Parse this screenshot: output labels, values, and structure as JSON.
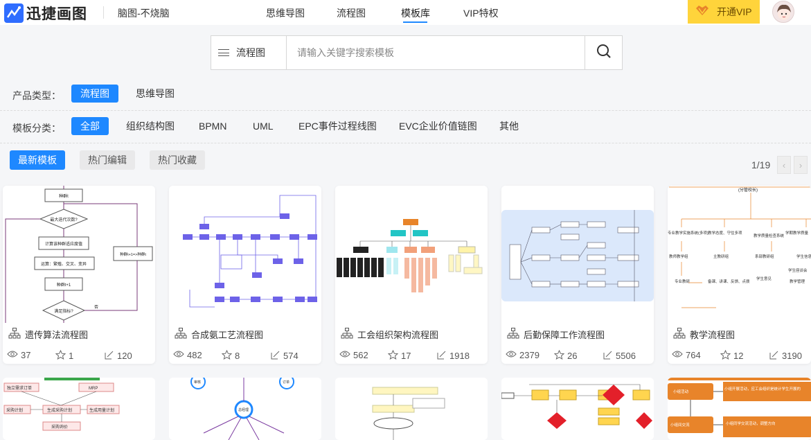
{
  "header": {
    "logo_text": "迅捷画图",
    "file_name": "脑图-不烧脑",
    "nav": [
      {
        "label": "思维导图"
      },
      {
        "label": "流程图"
      },
      {
        "label": "模板库",
        "active": true
      },
      {
        "label": "VIP特权"
      }
    ],
    "vip_label": "开通VIP",
    "accent_color": "#1e88ff",
    "vip_color": "#ffd43b"
  },
  "search": {
    "type_label": "流程图",
    "placeholder": "请输入关键字搜索模板",
    "icon": "search-icon"
  },
  "filters": {
    "product_type": {
      "label": "产品类型：",
      "options": [
        {
          "label": "流程图",
          "active": true
        },
        {
          "label": "思维导图"
        }
      ]
    },
    "category": {
      "label": "模板分类：",
      "options": [
        {
          "label": "全部",
          "active": true
        },
        {
          "label": "组织结构图"
        },
        {
          "label": "BPMN"
        },
        {
          "label": "UML"
        },
        {
          "label": "EPC事件过程线图"
        },
        {
          "label": "EVC企业价值链图"
        },
        {
          "label": "其他"
        }
      ]
    }
  },
  "sort": {
    "options": [
      {
        "label": "最新模板",
        "active": true
      },
      {
        "label": "热门编辑"
      },
      {
        "label": "热门收藏"
      }
    ]
  },
  "pagination": {
    "text": "1/19",
    "prev_icon": "chevron-left-icon",
    "next_icon": "chevron-right-icon"
  },
  "cards": [
    {
      "title": "遗传算法流程图",
      "views": "37",
      "likes": "1",
      "edits": "120"
    },
    {
      "title": "合成氨工艺流程图",
      "views": "482",
      "likes": "8",
      "edits": "574"
    },
    {
      "title": "工会组织架构流程图",
      "views": "562",
      "likes": "17",
      "edits": "1918"
    },
    {
      "title": "后勤保障工作流程图",
      "views": "2379",
      "likes": "26",
      "edits": "5506"
    },
    {
      "title": "教学流程图",
      "views": "764",
      "likes": "12",
      "edits": "3190"
    }
  ],
  "thumb_text": {
    "c1": [
      "种群t",
      "最大迭代次数?",
      "计算该种群适应度值",
      "运算：繁殖、交叉、变异",
      "种群t+1",
      "满足指标?",
      "种群t+1=>种群t",
      "否"
    ],
    "c5": [
      "(分管校长)",
      "专业教学实施系统(多项)",
      "教学态度、守住多项",
      "教学质量检查系统",
      "学期教学质量",
      "教师教学组",
      "主教研组",
      "系部教研组",
      "学生信息",
      "学生座谈会",
      "专业教研",
      "备课、讲课、反馈、点拨",
      "学生意见",
      "教学管理"
    ],
    "row2": {
      "a": [
        "独立需求订单",
        "MRP",
        "采购计划",
        "生成采购计划",
        "生成用量计划",
        "采购询价"
      ],
      "b": [
        "审核",
        "订单",
        "总经理"
      ],
      "e": [
        "小组活动",
        "小组开展活动，应工会组织是统计学生开展的",
        "小组间交流",
        "小组同学交流活动，调整方向"
      ]
    }
  }
}
